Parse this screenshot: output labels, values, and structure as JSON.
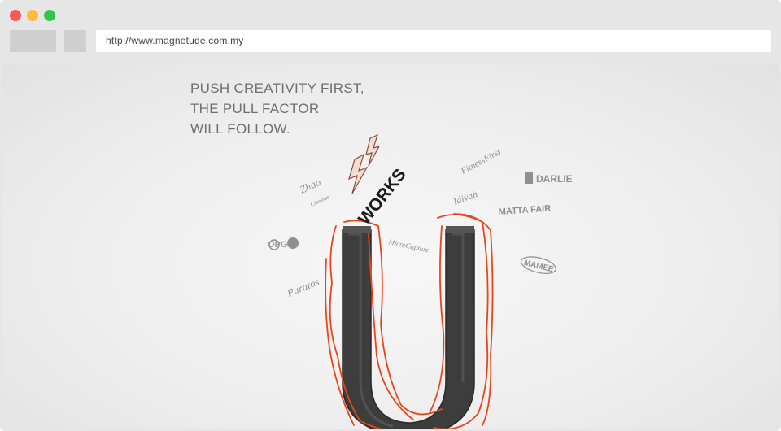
{
  "browser": {
    "url": "http://www.magnetude.com.my"
  },
  "page": {
    "tagline": [
      "PUSH CREATIVITY FIRST,",
      "THE PULL FACTOR",
      "WILL FOLLOW."
    ],
    "works_label": "WORKS",
    "client_logos": {
      "zhao": "Zhao",
      "cinemas": "Cinemas",
      "opg": "OPG",
      "puratos": "Puratos",
      "fitness_first": "FitnessFirst",
      "idivah": "Idivah",
      "darlie": "DARLIE",
      "matta_fair": "MATTA FAIR",
      "microcapture": "MicroCapture",
      "mamee": "MAMEE"
    }
  },
  "colors": {
    "scribble": "#e8461a",
    "magnet": "#3b3b3b"
  }
}
